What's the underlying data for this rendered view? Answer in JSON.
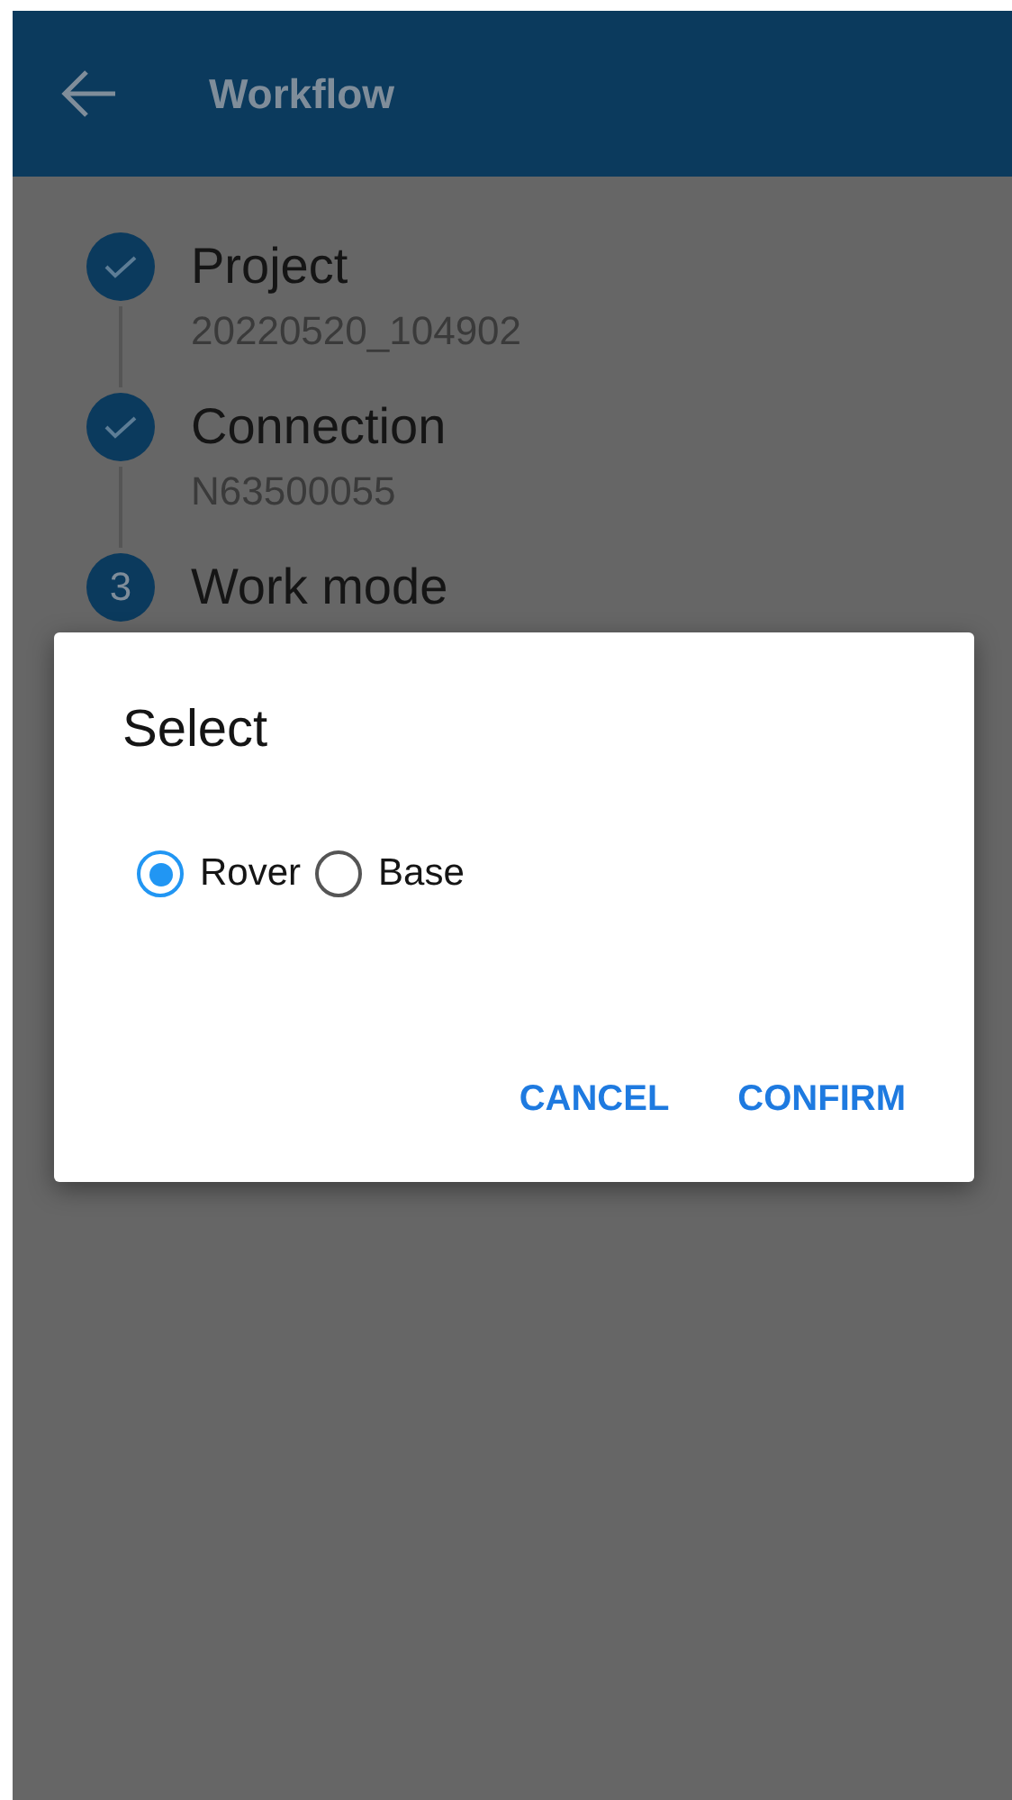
{
  "app_bar": {
    "title": "Workflow"
  },
  "steps": [
    {
      "kind": "done",
      "title": "Project",
      "subtitle": "20220520_104902"
    },
    {
      "kind": "done",
      "title": "Connection",
      "subtitle": "N63500055"
    },
    {
      "kind": "current",
      "number": "3",
      "title": "Work mode"
    }
  ],
  "dialog": {
    "title": "Select",
    "options": [
      {
        "label": "Rover",
        "selected": true
      },
      {
        "label": "Base",
        "selected": false
      }
    ],
    "buttons": [
      "CANCEL",
      "CONFIRM"
    ]
  }
}
